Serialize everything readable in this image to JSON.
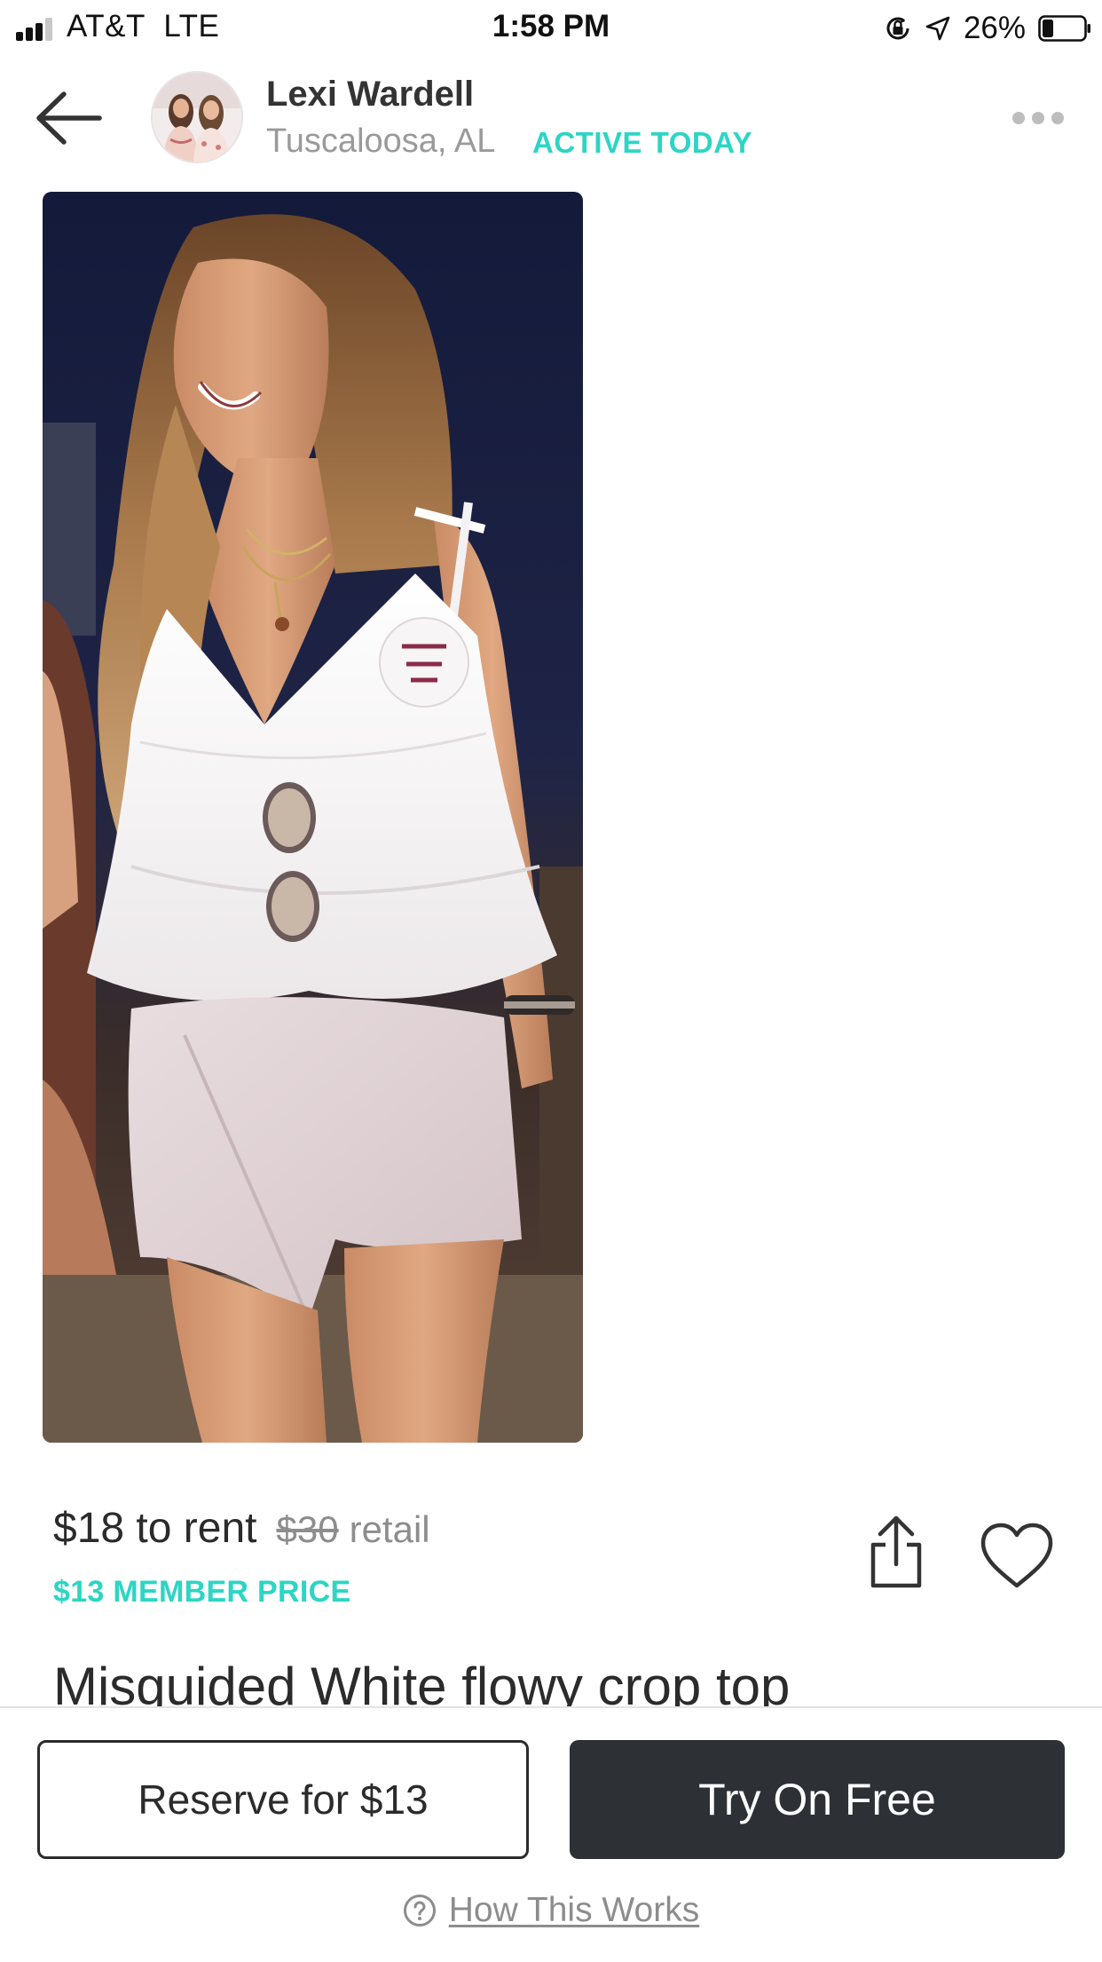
{
  "status_bar": {
    "carrier": "AT&T",
    "network": "LTE",
    "time": "1:58 PM",
    "battery_percent": "26%",
    "battery_level": 0.26
  },
  "header": {
    "seller_name": "Lexi Wardell",
    "seller_location": "Tuscaloosa, AL",
    "activity_status": "ACTIVE TODAY",
    "back_icon": "arrow-left-icon",
    "more_icon": "more-horizontal-icon"
  },
  "listing": {
    "rent_price": "$18 to rent",
    "retail_price": "$30",
    "retail_label": "retail",
    "member_price": "$13 MEMBER PRICE",
    "title": "Misguided White flowy crop top"
  },
  "actions": {
    "reserve_label": "Reserve for $13",
    "try_label": "Try On Free",
    "how_label": "How This Works"
  },
  "colors": {
    "accent_teal": "#2cd5c4",
    "dark_button": "#2d3035",
    "text_primary": "#2b2b2b",
    "text_muted": "#8d8d8d"
  }
}
